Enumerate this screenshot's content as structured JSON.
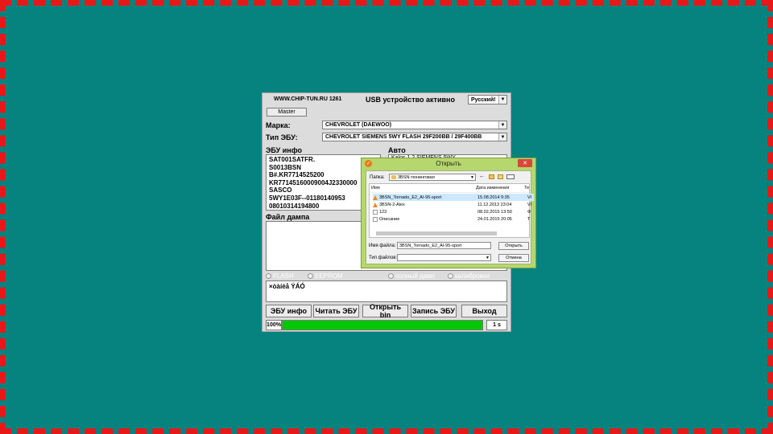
{
  "app": {
    "website": "WWW.CHIP-TUN.RU 1261",
    "usb_status": "USB устройство активно",
    "language": "Русский!",
    "master_button": "Master",
    "brand_label": "Марка:",
    "brand_value": "CHEVROLET (DAEWOO)",
    "ecu_type_label": "Тип ЭБУ:",
    "ecu_type_value": "CHEVROLET SIEMENS 5WY FLASH 29F200BB / 29F400BB",
    "ecu_info_label": "ЭБУ инфо",
    "ecu_info_lines": [
      "SAT001SATFR.",
      "S0013BSN",
      "B#.KR7714525200",
      "KR77145160009004J2330000",
      "SASCO",
      "5WY1E03F--01180140953",
      "08010314194800"
    ],
    "auto_label": "Авто",
    "auto_value": "Kalos 1.2 SIEMENS 5WY",
    "dump_label": "Файл дампа",
    "radio_flash": "FLASH",
    "radio_eeprom": "EEPROM",
    "radio_full_dump": "полный дамп",
    "radio_calibrations": "калибровки",
    "log_text": "×òàíèå ÝÁÓ",
    "buttons": {
      "ecu_info": "ЭБУ инфо",
      "read_ecu": "Читать ЭБУ",
      "open_bin": "Открыть bin",
      "write_ecu": "Запись ЭБУ",
      "exit": "Выход"
    },
    "progress_percent_label": "100%",
    "progress_value": 1.0,
    "time_label": "1 s",
    "progress_color": "#00c800"
  },
  "dialog": {
    "title": "Открыть",
    "folder_label": "Папка:",
    "folder_value": "3BSN-тюнинговая",
    "columns": {
      "name": "Имя",
      "date": "Дата изменения",
      "type": "Те"
    },
    "files": [
      {
        "name": "3BSN_Tornado_E2_AI-95-sport",
        "date": "15.08.2014 9:35",
        "type": "VI",
        "icon": "vlc-icon",
        "selected": true
      },
      {
        "name": "3BSN-2-Alex",
        "date": "11.12.2013 23:04",
        "type": "VI",
        "icon": "vlc-icon",
        "selected": false
      },
      {
        "name": "123",
        "date": "08.02.2015 13:50",
        "type": "Ф",
        "icon": "document-icon",
        "selected": false
      },
      {
        "name": "Описание",
        "date": "24.01.2015 20:05",
        "type": "Т",
        "icon": "document-icon",
        "selected": false
      }
    ],
    "filename_label": "Имя файла:",
    "filename_value": "3BSN_Tornado_E2_AI-95-sport",
    "filetype_label": "Тип файлов:",
    "filetype_value": "",
    "open_button": "Открыть",
    "cancel_button": "Отмена"
  }
}
